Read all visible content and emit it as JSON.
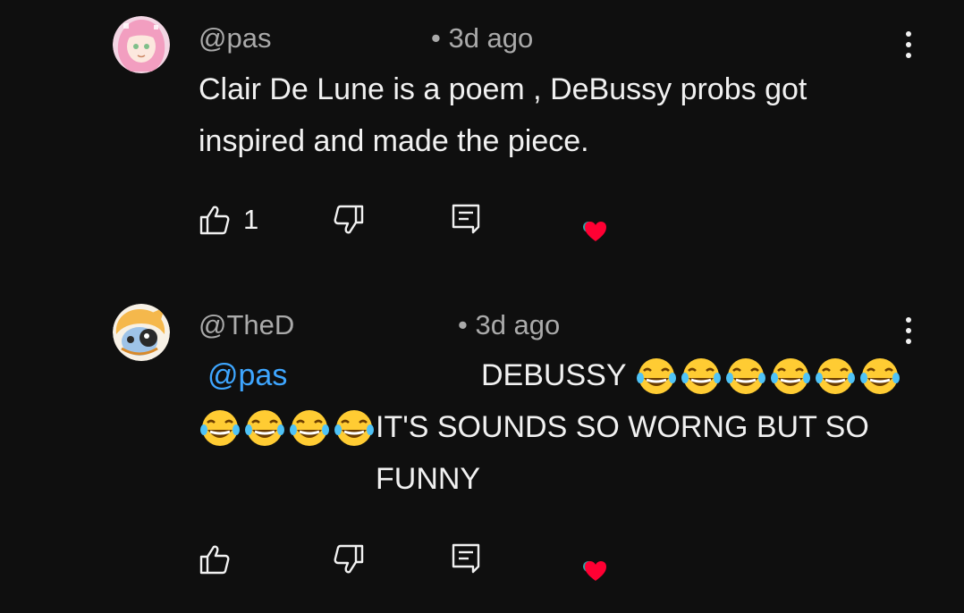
{
  "comments": [
    {
      "author": "@pas",
      "timestamp": "• 3d ago",
      "text": "Clair De Lune is a poem , DeBussy probs got inspired and made the piece.",
      "like_count": "1",
      "has_creator_heart": true
    },
    {
      "author": "@TheD",
      "timestamp": "• 3d ago",
      "mention": "@pas",
      "text_part1": "DEBUSSY",
      "text_part2": "IT'S SOUNDS SO WORNG BUT SO FUNNY",
      "emoji_part1": "😂😂😂😂😂😂",
      "emoji_part2": "😂😂😂😂",
      "like_count": "",
      "has_creator_heart": true
    }
  ],
  "icons": {
    "like": "thumbs-up-icon",
    "dislike": "thumbs-down-icon",
    "reply": "reply-icon",
    "menu": "more-vert-icon",
    "heart": "creator-heart-icon"
  },
  "colors": {
    "background": "#0f0f0f",
    "text": "#f1f1f1",
    "secondary": "#aaaaaa",
    "mention": "#3ea6ff",
    "heart": "#ff0033"
  }
}
